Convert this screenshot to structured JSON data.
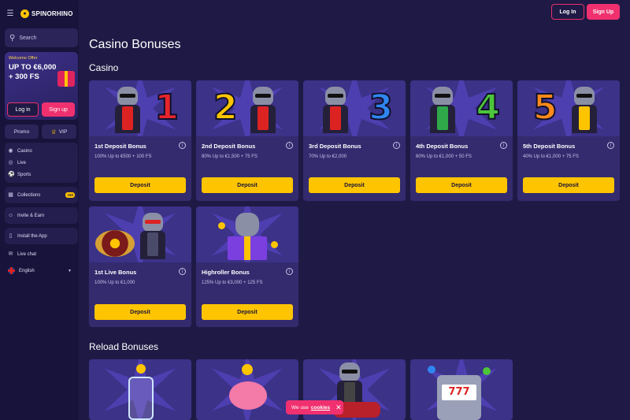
{
  "brand": {
    "name": "SPINORHINO"
  },
  "sidebar": {
    "search_label": "Search",
    "welcome": {
      "tag": "Welcome Offer",
      "line1": "UP TO €6,000",
      "line2": "+ 300 FS",
      "login": "Log in",
      "signup": "Sign up"
    },
    "promo": "Promo",
    "vip": "VIP",
    "nav1": [
      "Casino",
      "Live",
      "Sports"
    ],
    "collections": {
      "label": "Collections",
      "badge": "150"
    },
    "invite": "Invite & Earn",
    "install": "Install the App",
    "live_chat": "Live chat",
    "language": "English"
  },
  "header": {
    "login": "Log In",
    "signup": "Sign Up"
  },
  "page": {
    "title": "Casino Bonuses",
    "section_casino": "Casino",
    "section_reload": "Reload Bonuses"
  },
  "cards": [
    {
      "name": "1st Deposit Bonus",
      "desc": "100% Up to €500 + 100 FS",
      "button": "Deposit",
      "digit": "1",
      "digit_color": "#e8242c"
    },
    {
      "name": "2nd Deposit Bonus",
      "desc": "80% Up to €1,500 + 75 FS",
      "button": "Deposit",
      "digit": "2",
      "digit_color": "#ffc400"
    },
    {
      "name": "3rd Deposit Bonus",
      "desc": "70% Up to €2,000",
      "button": "Deposit",
      "digit": "3",
      "digit_color": "#2f86f0"
    },
    {
      "name": "4th Deposit Bonus",
      "desc": "60% Up to €1,000 + 50 FS",
      "button": "Deposit",
      "digit": "4",
      "digit_color": "#4cc53a"
    },
    {
      "name": "5th Deposit Bonus",
      "desc": "40% Up to €1,000 + 75 FS",
      "button": "Deposit",
      "digit": "5",
      "digit_color": "#ff8a1a"
    },
    {
      "name": "1st Live Bonus",
      "desc": "100% Up to €1,000",
      "button": "Deposit"
    },
    {
      "name": "Highroller Bonus",
      "desc": "125% Up to €3,000 + 125 FS",
      "button": "Deposit"
    }
  ],
  "cookie": {
    "text": "We use",
    "link": "cookies"
  }
}
